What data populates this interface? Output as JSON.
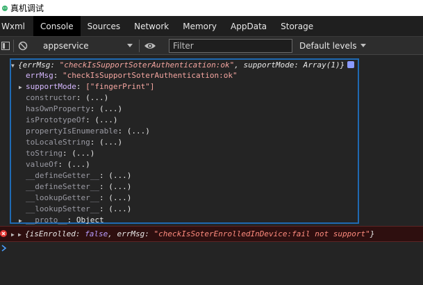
{
  "window": {
    "title": "真机调试"
  },
  "tabs": [
    {
      "label": "Wxml"
    },
    {
      "label": "Console"
    },
    {
      "label": "Sources"
    },
    {
      "label": "Network"
    },
    {
      "label": "Memory"
    },
    {
      "label": "AppData"
    },
    {
      "label": "Storage"
    }
  ],
  "toolbar": {
    "context": "appservice",
    "filter_placeholder": "Filter",
    "levels": "Default levels"
  },
  "console": {
    "object_summary": {
      "brace_open": "{",
      "k1": "errMsg",
      "sep1": ": ",
      "v1": "\"checkIsSupportSoterAuthentication:ok\"",
      "comma": ", ",
      "k2": "supportMode",
      "sep2": ": ",
      "v2": "Array(1)",
      "brace_close": "}"
    },
    "props": [
      {
        "key": "errMsg",
        "sep": ": ",
        "value": "\"checkIsSupportSoterAuthentication:ok\""
      },
      {
        "key": "supportMode",
        "sep": ": ",
        "value": "[\"fingerPrint\"]"
      },
      {
        "key": "constructor",
        "sep": ": ",
        "value": "(...)"
      },
      {
        "key": "hasOwnProperty",
        "sep": ": ",
        "value": "(...)"
      },
      {
        "key": "isPrototypeOf",
        "sep": ": ",
        "value": "(...)"
      },
      {
        "key": "propertyIsEnumerable",
        "sep": ": ",
        "value": "(...)"
      },
      {
        "key": "toLocaleString",
        "sep": ": ",
        "value": "(...)"
      },
      {
        "key": "toString",
        "sep": ": ",
        "value": "(...)"
      },
      {
        "key": "valueOf",
        "sep": ": ",
        "value": "(...)"
      },
      {
        "key": "__defineGetter__",
        "sep": ": ",
        "value": "(...)"
      },
      {
        "key": "__defineSetter__",
        "sep": ": ",
        "value": "(...)"
      },
      {
        "key": "__lookupGetter__",
        "sep": ": ",
        "value": "(...)"
      },
      {
        "key": "__lookupSetter__",
        "sep": ": ",
        "value": "(...)"
      },
      {
        "key": "__proto__",
        "sep": ": ",
        "value": "Object"
      }
    ],
    "error_line": {
      "brace_open": "{",
      "k1": "isEnrolled",
      "sep1": ": ",
      "v1": "false",
      "comma": ", ",
      "k2": "errMsg",
      "sep2": ": ",
      "v2": "\"checkIsSoterEnrolledInDevice:fail not support\"",
      "brace_close": "}"
    }
  },
  "colors": {
    "accent_border": "#1f6ab3",
    "error_bg": "#2e0f0f",
    "error_icon": "#e53935"
  }
}
